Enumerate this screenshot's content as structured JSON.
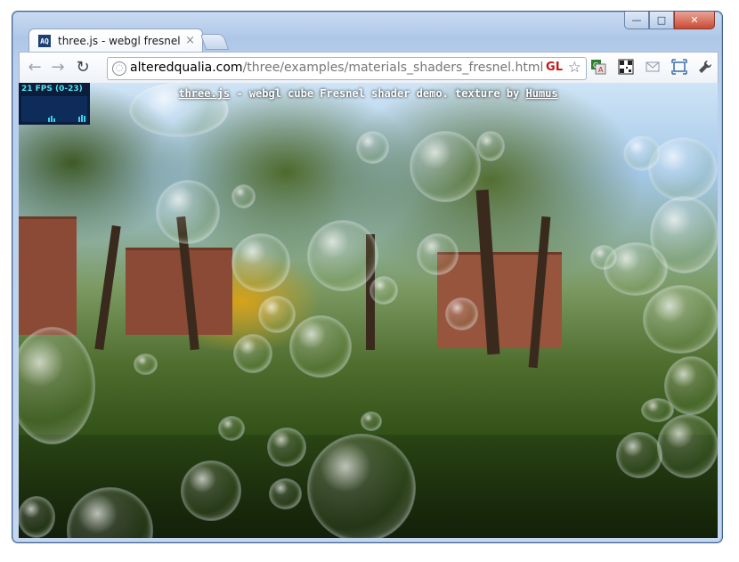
{
  "window": {
    "controls": {
      "minimize": "—",
      "maximize": "□",
      "close": "✕"
    }
  },
  "tab": {
    "favicon_text": "AQ",
    "title": "three.js - webgl fresnel",
    "close": "×"
  },
  "toolbar": {
    "back": "←",
    "forward": "→",
    "reload": "↻",
    "url_host": "alteredqualia.com",
    "url_path": "/three/examples/materials_shaders_fresnel.html",
    "gl_badge": "GL",
    "star": "☆"
  },
  "extensions": [
    "translate-icon",
    "qr-code-icon",
    "mail-icon",
    "fullscreen-icon",
    "wrench-icon"
  ],
  "stats": {
    "fps_label": "21 FPS (0-23)"
  },
  "info": {
    "link_threejs": "three.js",
    "middle": " - webgl cube Fresnel shader demo. texture by ",
    "link_humus": "Humus"
  }
}
